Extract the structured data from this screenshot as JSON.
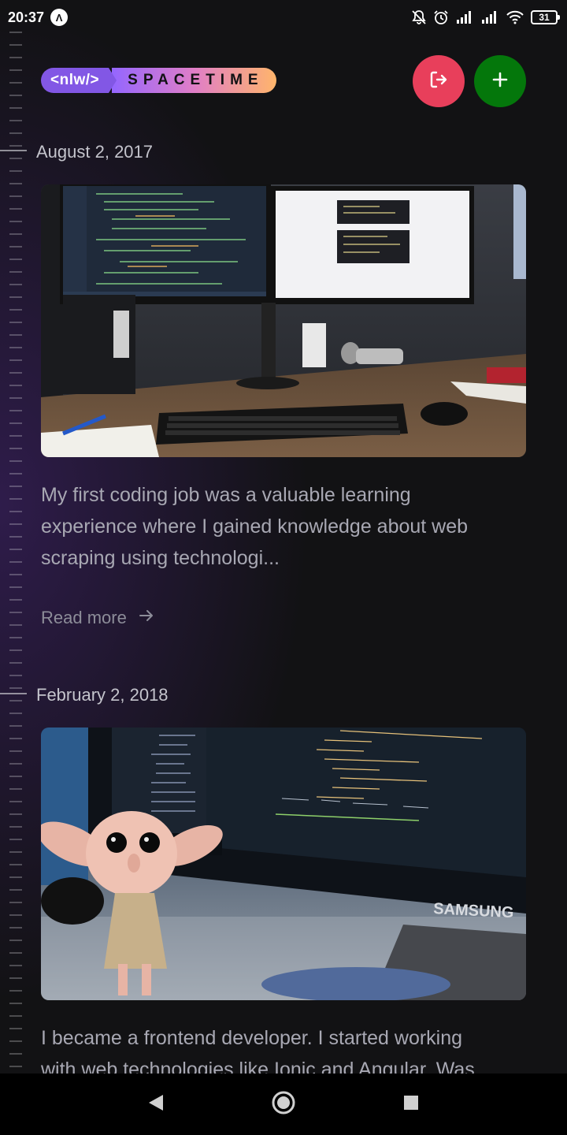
{
  "status_bar": {
    "time": "20:37",
    "app_icon_glyph": "Λ",
    "battery": "31"
  },
  "header": {
    "logo_left": "<nlw/>",
    "logo_right": "SPACETIME",
    "logout_icon": "logout-icon",
    "add_icon": "plus-icon",
    "logout_color": "#e83f5b",
    "add_color": "#04770b"
  },
  "memories": [
    {
      "date": "August 2, 2017",
      "excerpt_line1": "My first coding job was a valuable learning",
      "excerpt_line2": "experience where I gained knowledge about web",
      "excerpt_line3": "scraping using technologi...",
      "read_more": "Read more",
      "photo": "desk-with-two-monitors-keyboard-mouse"
    },
    {
      "date": "February 2, 2018",
      "excerpt_line1": "I became a frontend developer. I started working",
      "excerpt_line2": "with web technologies like Ionic and Angular. Was",
      "photo": "samsung-monitor-with-code-and-dobby-figure",
      "monitor_brand": "SAMSUNG",
      "code_lines": [
        "<div> {{ objeto_feed.qtd_comments }} Coments </div>",
        "</button>",
        "</ion-col>",
        "<ion-col center text-center>",
        "<ion-note>",
        "{{objeto_feed.time_coment}}",
        "</ion-note>",
        "</ion-col>"
      ],
      "file_tree": [
        "tabs.html",
        "tabs.ts",
        "providers",
        "movie",
        "movie.ts",
        "theme",
        "index.html",
        "manifest.json",
        "service-worker.js"
      ],
      "panel_tabs": [
        "PROBLEMS",
        "OUTPUT",
        "DEBUG CONSOLE",
        "TERMINAL"
      ],
      "terminal_prompt": "Infocap@DESKTOP-P5G3OV MINGW64 ~/Documents/Ionic3"
    }
  ],
  "nav_bar": {
    "back_icon": "back-triangle-icon",
    "home_icon": "home-circle-icon",
    "recents_icon": "recents-square-icon"
  }
}
